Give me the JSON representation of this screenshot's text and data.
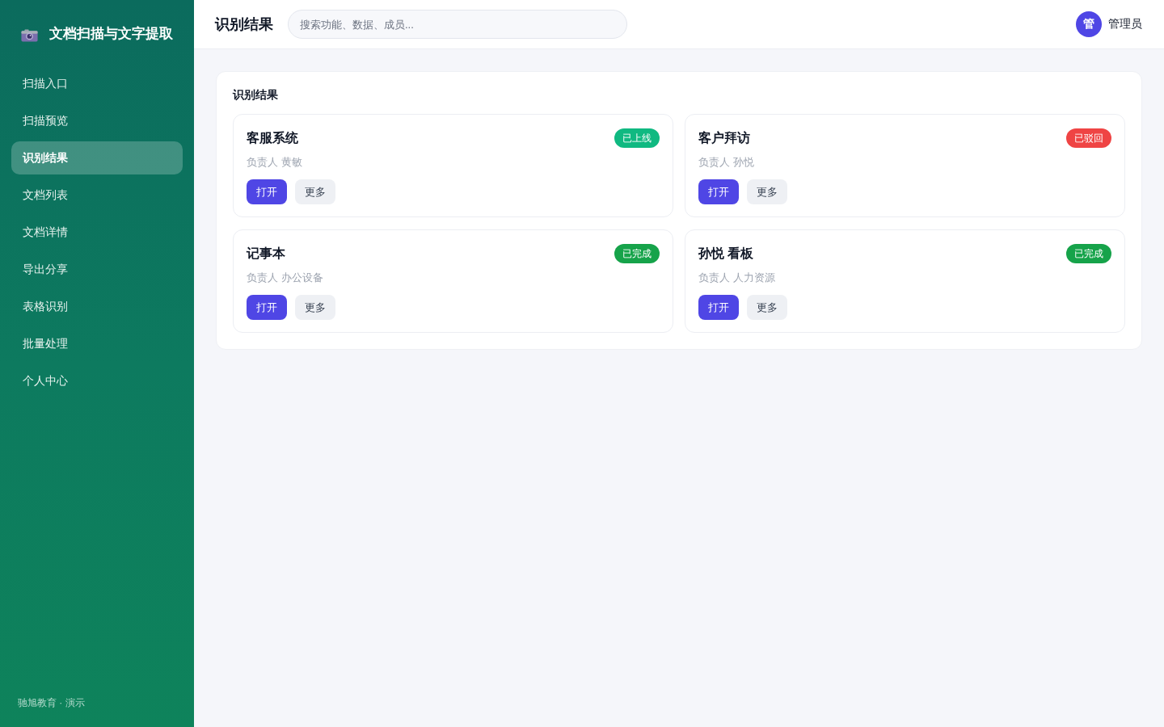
{
  "sidebar": {
    "brand": "文档扫描与文字提取",
    "items": [
      {
        "label": "扫描入口",
        "selected": false
      },
      {
        "label": "扫描预览",
        "selected": false
      },
      {
        "label": "识别结果",
        "selected": true
      },
      {
        "label": "文档列表",
        "selected": false
      },
      {
        "label": "文档详情",
        "selected": false
      },
      {
        "label": "导出分享",
        "selected": false
      },
      {
        "label": "表格识别",
        "selected": false
      },
      {
        "label": "批量处理",
        "selected": false
      },
      {
        "label": "个人中心",
        "selected": false
      }
    ],
    "footer": "驰旭教育 · 演示"
  },
  "header": {
    "title": "识别结果",
    "search": {
      "placeholder": "搜索功能、数据、成员..."
    },
    "user": {
      "avatar": "管",
      "name": "管理员"
    }
  },
  "panel": {
    "title": "识别结果",
    "cards": [
      {
        "title": "客服系统",
        "status": {
          "label": "已上线",
          "color": "#10b981"
        },
        "owner": "负责人 黄敏",
        "actions": [
          {
            "label": "打开",
            "kind": "primary"
          },
          {
            "label": "更多",
            "kind": "secondary"
          }
        ]
      },
      {
        "title": "客户拜访",
        "status": {
          "label": "已驳回",
          "color": "#ef4444"
        },
        "owner": "负责人 孙悦",
        "actions": [
          {
            "label": "打开",
            "kind": "primary"
          },
          {
            "label": "更多",
            "kind": "secondary"
          }
        ]
      },
      {
        "title": "记事本",
        "status": {
          "label": "已完成",
          "color": "#16a34a"
        },
        "owner": "负责人 办公设备",
        "actions": [
          {
            "label": "打开",
            "kind": "primary"
          },
          {
            "label": "更多",
            "kind": "secondary"
          }
        ]
      },
      {
        "title": "孙悦 看板",
        "status": {
          "label": "已完成",
          "color": "#16a34a"
        },
        "owner": "负责人 人力资源",
        "actions": [
          {
            "label": "打开",
            "kind": "primary"
          },
          {
            "label": "更多",
            "kind": "secondary"
          }
        ]
      }
    ]
  }
}
